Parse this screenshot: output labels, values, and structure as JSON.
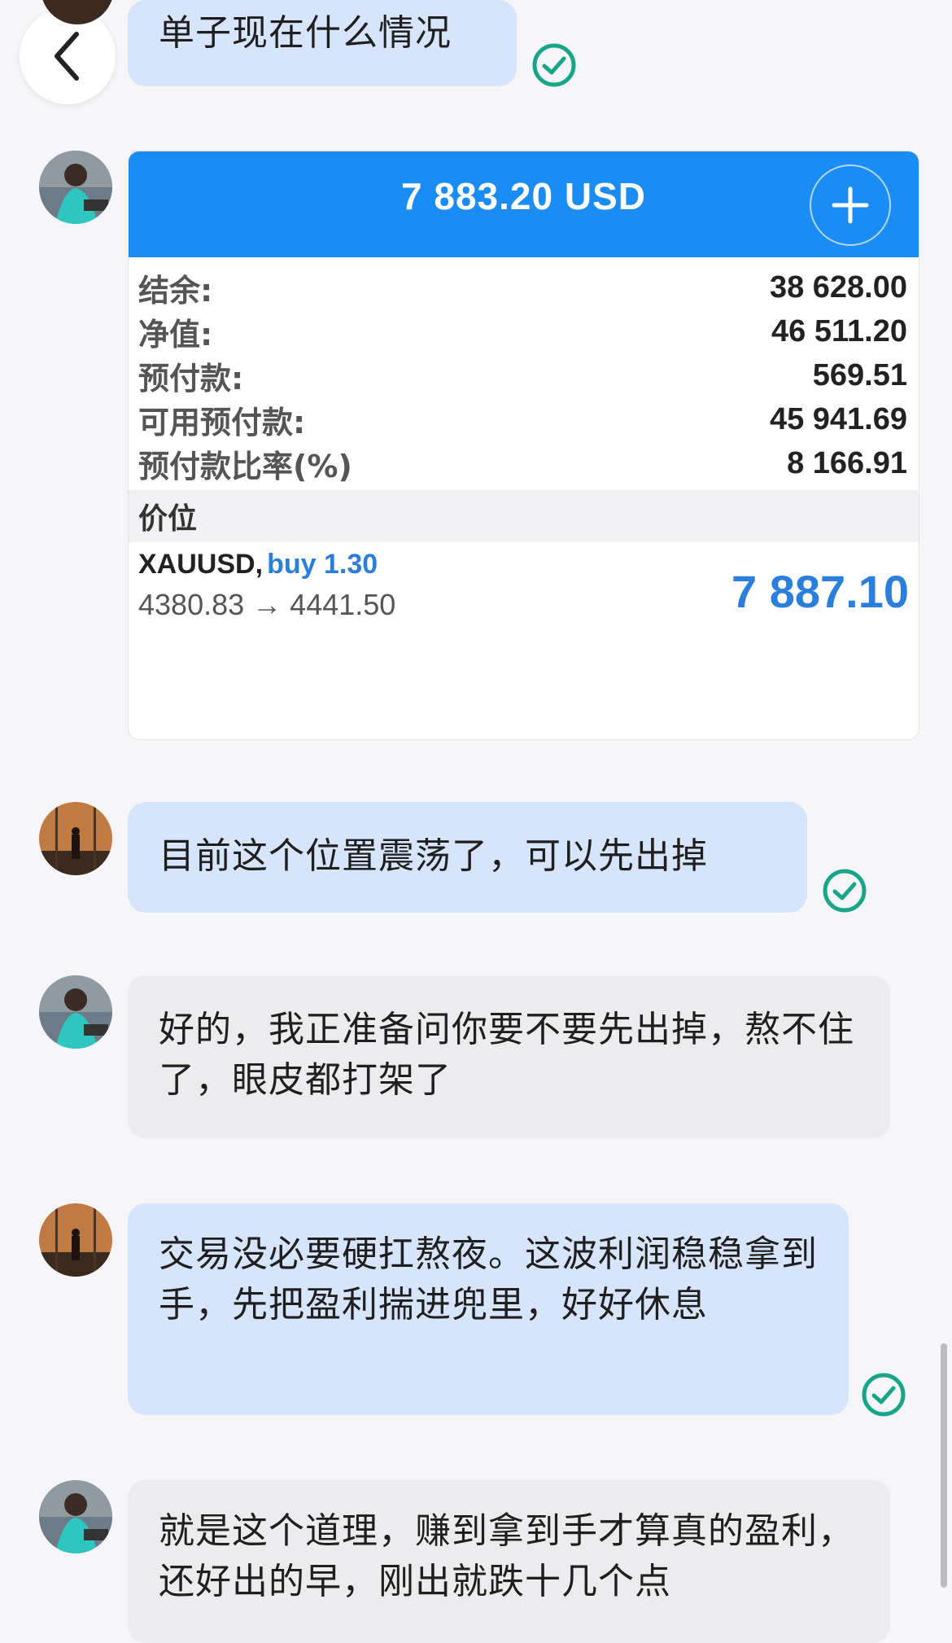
{
  "nav": {
    "back_icon": "chevron-left-icon"
  },
  "colors": {
    "accent": "#1b8cf3",
    "sent_bubble": "#d7e5fc",
    "received_bubble": "#ececef",
    "read_check": "#19a58a",
    "profit": "#2b7fdc"
  },
  "messages": [
    {
      "side": "sent",
      "text": "单子现在什么情况",
      "status": "read"
    },
    {
      "side": "received",
      "type": "image-card"
    },
    {
      "side": "sent",
      "text": "目前这个位置震荡了，可以先出掉",
      "status": "read"
    },
    {
      "side": "received",
      "text": "好的，我正准备问你要不要先出掉，熬不住了，眼皮都打架了"
    },
    {
      "side": "sent",
      "text": "交易没必要硬扛熬夜。这波利润稳稳拿到手，先把盈利揣进兜里，好好休息",
      "status": "read"
    },
    {
      "side": "received",
      "text": "就是这个道理，赚到拿到手才算真的盈利，还好出的早，刚出就跌十几个点"
    }
  ],
  "trading_card": {
    "total": "7 883.20 USD",
    "account": [
      {
        "label": "结余:",
        "value": "38 628.00"
      },
      {
        "label": "净值:",
        "value": "46 511.20"
      },
      {
        "label": "预付款:",
        "value": "569.51"
      },
      {
        "label": "可用预付款:",
        "value": "45 941.69"
      },
      {
        "label": "预付款比率(%)",
        "value": "8 166.91"
      }
    ],
    "section_title": "价位",
    "position": {
      "symbol": "XAUUSD,",
      "side": "buy 1.30",
      "open_price": "4380.83",
      "arrow": "→",
      "current_price": "4441.50",
      "profit": "7 887.10"
    }
  }
}
